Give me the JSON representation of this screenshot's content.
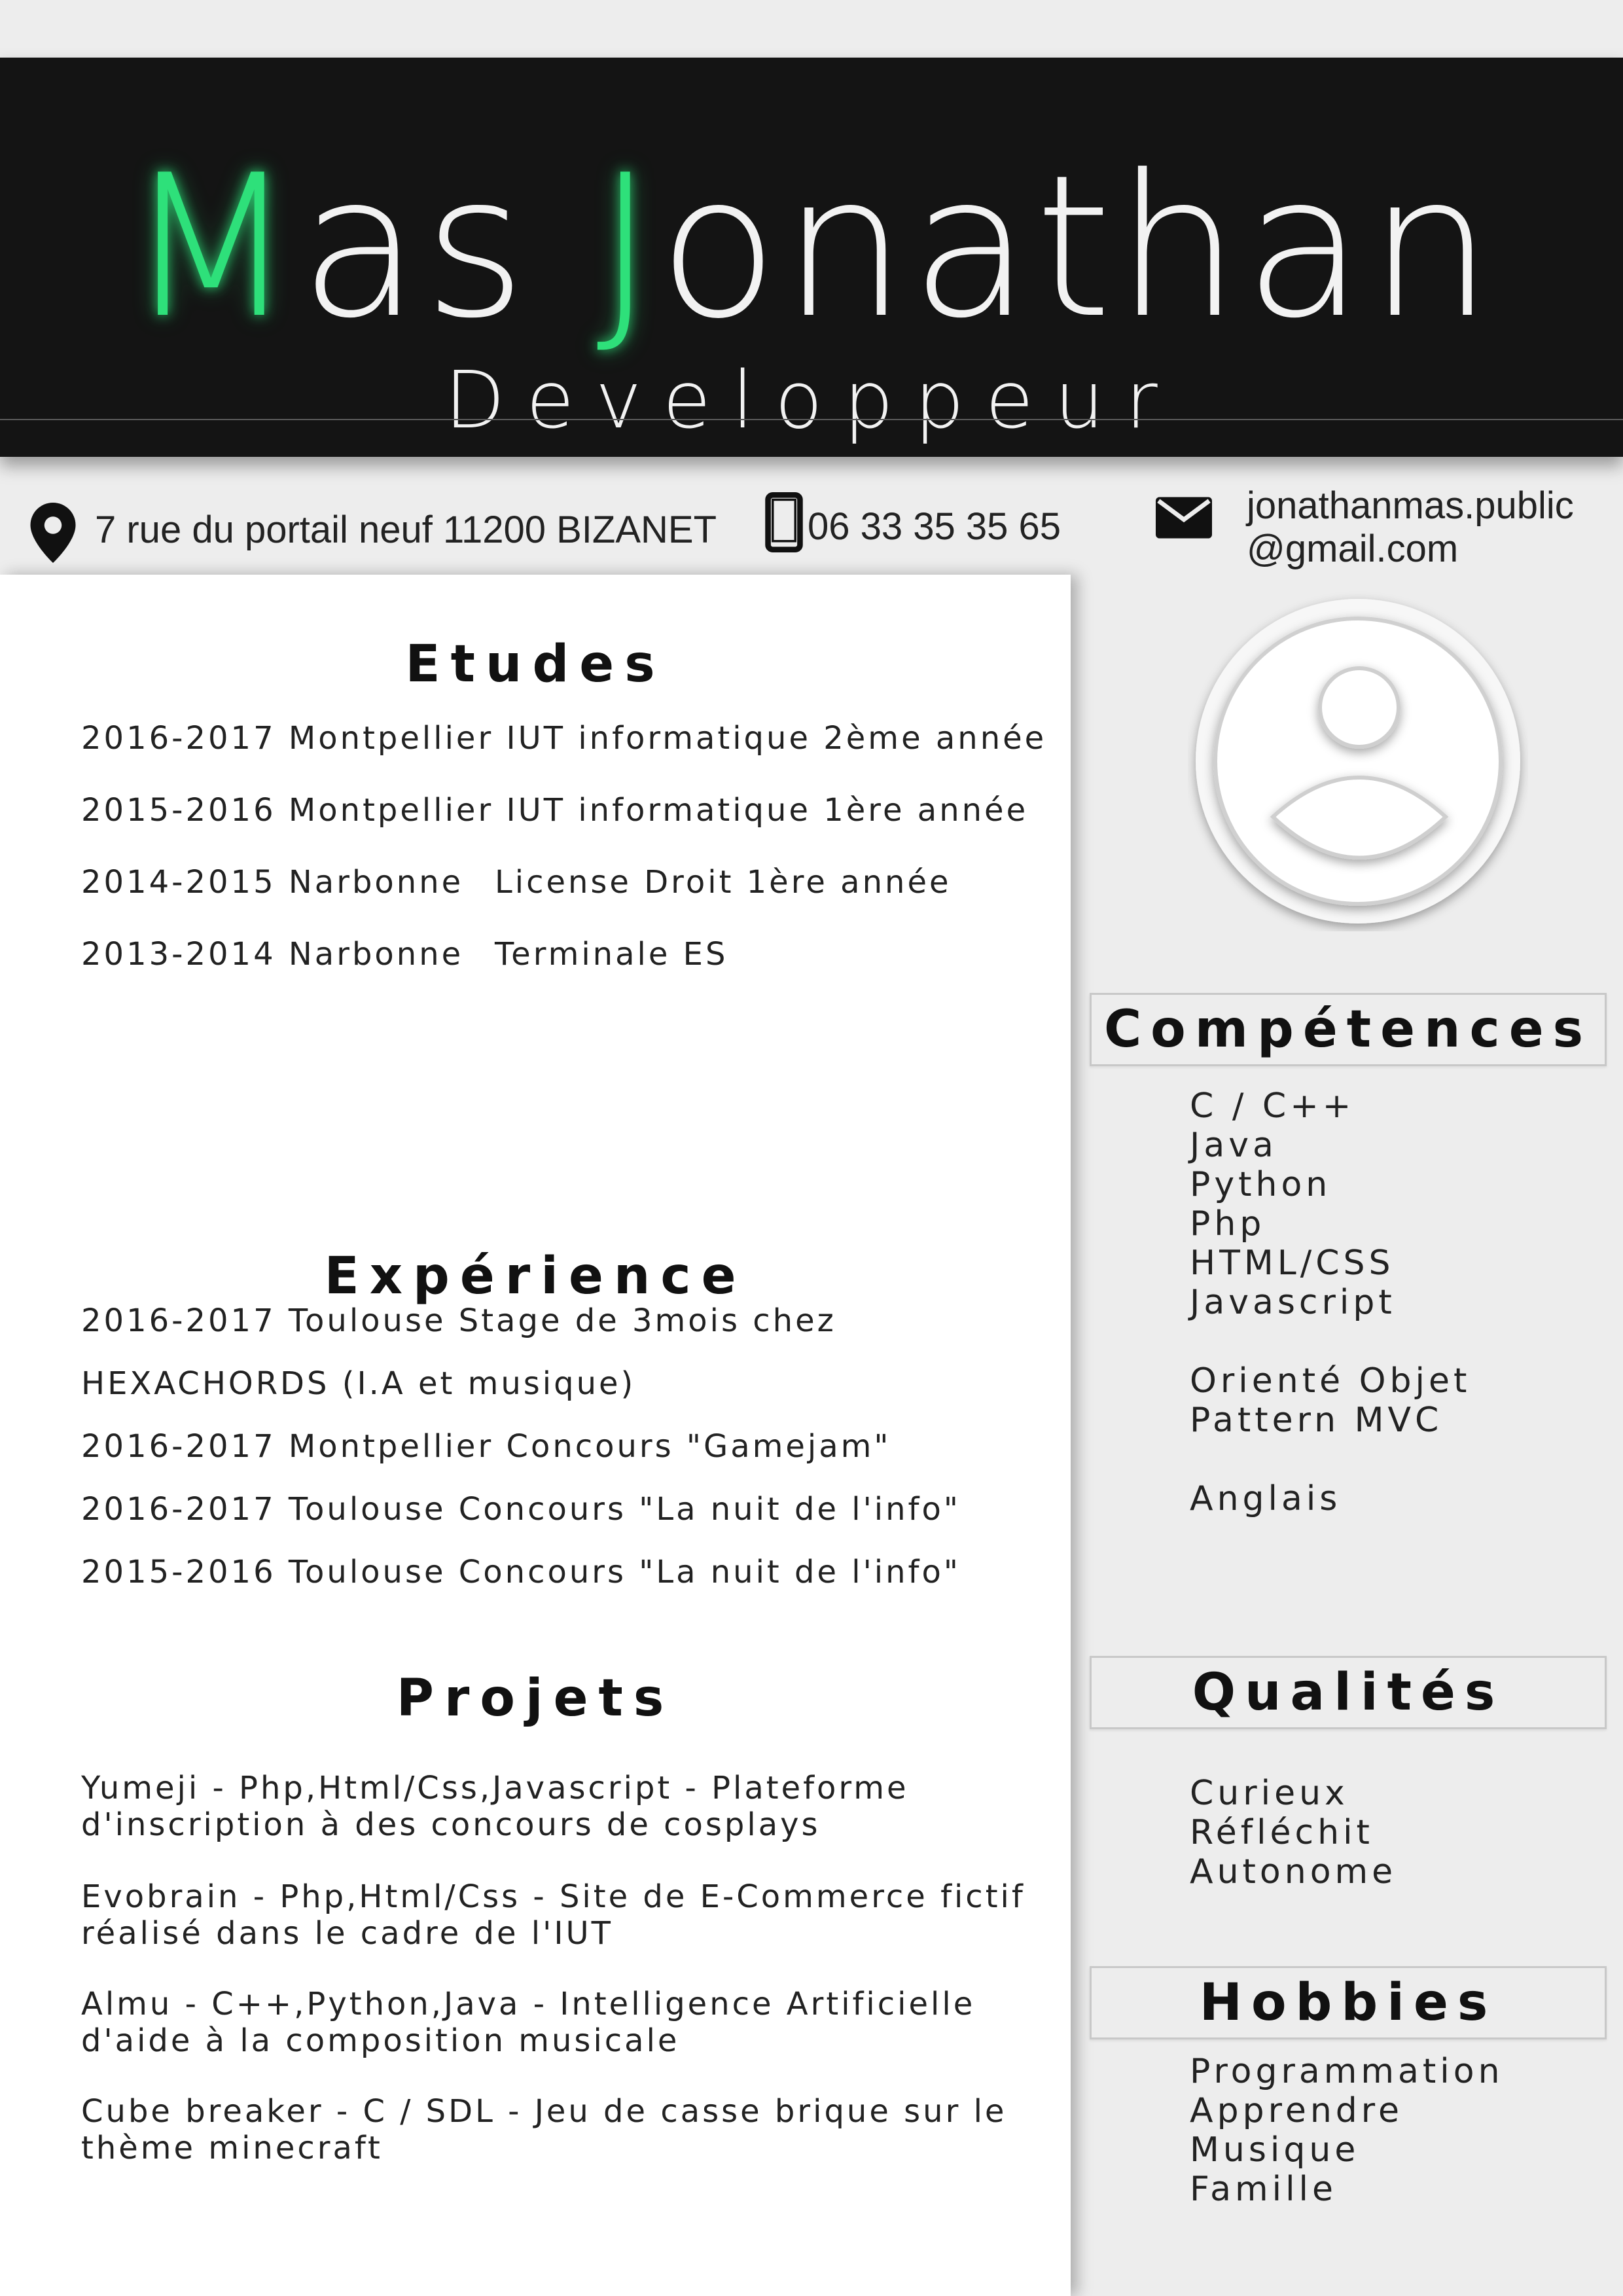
{
  "header": {
    "name_initial_1": "M",
    "name_rest_1": "as ",
    "name_initial_2": "J",
    "name_rest_2": "onathan",
    "job_title": "Developpeur"
  },
  "contact": {
    "address": "7 rue du portail neuf 11200 BIZANET",
    "phone": "06 33 35 35 65",
    "email_line_1": "jonathanmas.public",
    "email_line_2": "@gmail.com"
  },
  "etudes": {
    "title": "Etudes",
    "items": [
      {
        "col1": "2016-2017 Montpellier IUT informatique 2ème année",
        "col2": ""
      },
      {
        "col1": "2015-2016 Montpellier IUT informatique 1ère année",
        "col2": ""
      },
      {
        "col1": "2014-2015 Narbonne",
        "col2": "License Droit 1ère année"
      },
      {
        "col1": "2013-2014 Narbonne",
        "col2": "Terminale ES"
      }
    ]
  },
  "experience": {
    "title": "Expérience",
    "items": [
      "2016-2017 Toulouse Stage de 3mois chez",
      "HEXACHORDS (I.A et musique)",
      "2016-2017 Montpellier Concours \"Gamejam\"",
      "2016-2017 Toulouse Concours \"La nuit de l'info\"",
      "2015-2016 Toulouse Concours \"La nuit de l'info\""
    ]
  },
  "projets": {
    "title": "Projets",
    "items": [
      {
        "line1": "Yumeji - Php,Html/Css,Javascript - Plateforme",
        "line2": "d'inscription à des concours de cosplays"
      },
      {
        "line1": "Evobrain - Php,Html/Css - Site de E-Commerce fictif",
        "line2": "réalisé dans le cadre de l'IUT"
      },
      {
        "line1": "Almu - C++,Python,Java - Intelligence Artificielle",
        "line2": "d'aide à la composition musicale"
      },
      {
        "line1": "Cube breaker - C / SDL - Jeu de casse brique sur le",
        "line2": "thème minecraft"
      }
    ]
  },
  "competences": {
    "title": "Compétences",
    "items": [
      "C / C++",
      "Java",
      "Python",
      "Php",
      "HTML/CSS",
      "Javascript",
      "Orienté Objet",
      "Pattern MVC",
      "Anglais"
    ]
  },
  "qualites": {
    "title": "Qualités",
    "items": [
      "Curieux",
      "Réfléchit",
      "Autonome"
    ]
  },
  "hobbies": {
    "title": "Hobbies",
    "items": [
      "Programmation",
      "Apprendre",
      "Musique",
      "Famille"
    ]
  },
  "icons": {
    "address": "map-pin-icon",
    "phone": "smartphone-icon",
    "email": "envelope-icon",
    "avatar": "user-avatar-icon"
  },
  "colors": {
    "accent": "#2ee07a",
    "header_bg": "#141414",
    "page_bg": "#ededed",
    "panel_bg": "#ffffff"
  }
}
